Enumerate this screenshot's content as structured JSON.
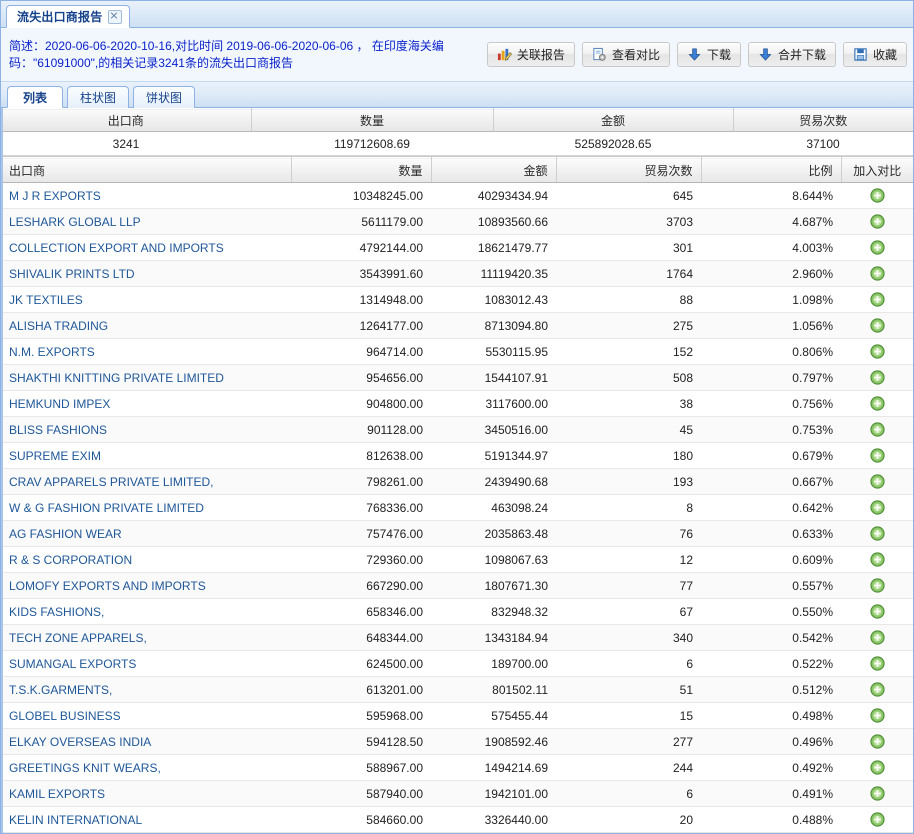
{
  "window": {
    "tab_label": "流失出口商报告",
    "close_icon": "close-icon"
  },
  "band": {
    "description_line1": "简述：2020-06-06-2020-10-16,对比时间 2019-06-06-2020-06-06 ， 在印度海关编",
    "description_line2": "码：\"61091000\",的相关记录3241条的流失出口商报告",
    "text_color": "#0a22cc"
  },
  "toolbar": {
    "buttons": [
      {
        "label": "关联报告",
        "icon": "bar-chart-edit-icon"
      },
      {
        "label": "查看对比",
        "icon": "document-settings-icon"
      },
      {
        "label": "下载",
        "icon": "download-arrow-icon"
      },
      {
        "label": "合并下载",
        "icon": "download-arrow-icon"
      },
      {
        "label": "收藏",
        "icon": "save-floppy-icon"
      }
    ]
  },
  "subtabs": [
    {
      "label": "列表",
      "active": true
    },
    {
      "label": "柱状图",
      "active": false
    },
    {
      "label": "饼状图",
      "active": false
    }
  ],
  "summary": {
    "headers": [
      "出口商",
      "数量",
      "金额",
      "贸易次数"
    ],
    "values": [
      "3241",
      "119712608.69",
      "525892028.65",
      "37100"
    ]
  },
  "detail": {
    "headers": [
      {
        "label": "出口商",
        "align": "l"
      },
      {
        "label": "数量",
        "align": "r"
      },
      {
        "label": "金额",
        "align": "r"
      },
      {
        "label": "贸易次数",
        "align": "r"
      },
      {
        "label": "比例",
        "align": "r"
      },
      {
        "label": "加入对比",
        "align": "c"
      }
    ],
    "action_icon": "add-circle-icon",
    "rows": [
      {
        "name": "M J R EXPORTS",
        "quantity": "10348245.00",
        "amount": "40293434.94",
        "trades": "645",
        "ratio": "8.644%"
      },
      {
        "name": "LESHARK GLOBAL LLP",
        "quantity": "5611179.00",
        "amount": "10893560.66",
        "trades": "3703",
        "ratio": "4.687%"
      },
      {
        "name": "COLLECTION EXPORT AND IMPORTS",
        "quantity": "4792144.00",
        "amount": "18621479.77",
        "trades": "301",
        "ratio": "4.003%"
      },
      {
        "name": "SHIVALIK PRINTS LTD",
        "quantity": "3543991.60",
        "amount": "11119420.35",
        "trades": "1764",
        "ratio": "2.960%"
      },
      {
        "name": "JK TEXTILES",
        "quantity": "1314948.00",
        "amount": "1083012.43",
        "trades": "88",
        "ratio": "1.098%"
      },
      {
        "name": "ALISHA TRADING",
        "quantity": "1264177.00",
        "amount": "8713094.80",
        "trades": "275",
        "ratio": "1.056%"
      },
      {
        "name": "N.M. EXPORTS",
        "quantity": "964714.00",
        "amount": "5530115.95",
        "trades": "152",
        "ratio": "0.806%"
      },
      {
        "name": "SHAKTHI KNITTING PRIVATE LIMITED",
        "quantity": "954656.00",
        "amount": "1544107.91",
        "trades": "508",
        "ratio": "0.797%"
      },
      {
        "name": "HEMKUND IMPEX",
        "quantity": "904800.00",
        "amount": "3117600.00",
        "trades": "38",
        "ratio": "0.756%"
      },
      {
        "name": "BLISS FASHIONS",
        "quantity": "901128.00",
        "amount": "3450516.00",
        "trades": "45",
        "ratio": "0.753%"
      },
      {
        "name": "SUPREME EXIM",
        "quantity": "812638.00",
        "amount": "5191344.97",
        "trades": "180",
        "ratio": "0.679%"
      },
      {
        "name": "CRAV APPARELS PRIVATE LIMITED,",
        "quantity": "798261.00",
        "amount": "2439490.68",
        "trades": "193",
        "ratio": "0.667%"
      },
      {
        "name": "W & G FASHION PRIVATE LIMITED",
        "quantity": "768336.00",
        "amount": "463098.24",
        "trades": "8",
        "ratio": "0.642%"
      },
      {
        "name": "AG FASHION WEAR",
        "quantity": "757476.00",
        "amount": "2035863.48",
        "trades": "76",
        "ratio": "0.633%"
      },
      {
        "name": "R & S CORPORATION",
        "quantity": "729360.00",
        "amount": "1098067.63",
        "trades": "12",
        "ratio": "0.609%"
      },
      {
        "name": "LOMOFY EXPORTS AND IMPORTS",
        "quantity": "667290.00",
        "amount": "1807671.30",
        "trades": "77",
        "ratio": "0.557%"
      },
      {
        "name": "KIDS FASHIONS,",
        "quantity": "658346.00",
        "amount": "832948.32",
        "trades": "67",
        "ratio": "0.550%"
      },
      {
        "name": "TECH ZONE APPARELS,",
        "quantity": "648344.00",
        "amount": "1343184.94",
        "trades": "340",
        "ratio": "0.542%"
      },
      {
        "name": "SUMANGAL EXPORTS",
        "quantity": "624500.00",
        "amount": "189700.00",
        "trades": "6",
        "ratio": "0.522%"
      },
      {
        "name": "T.S.K.GARMENTS,",
        "quantity": "613201.00",
        "amount": "801502.11",
        "trades": "51",
        "ratio": "0.512%"
      },
      {
        "name": "GLOBEL BUSINESS",
        "quantity": "595968.00",
        "amount": "575455.44",
        "trades": "15",
        "ratio": "0.498%"
      },
      {
        "name": "ELKAY OVERSEAS INDIA",
        "quantity": "594128.50",
        "amount": "1908592.46",
        "trades": "277",
        "ratio": "0.496%"
      },
      {
        "name": "GREETINGS KNIT WEARS,",
        "quantity": "588967.00",
        "amount": "1494214.69",
        "trades": "244",
        "ratio": "0.492%"
      },
      {
        "name": "KAMIL EXPORTS",
        "quantity": "587940.00",
        "amount": "1942101.00",
        "trades": "6",
        "ratio": "0.491%"
      },
      {
        "name": "KELIN INTERNATIONAL",
        "quantity": "584660.00",
        "amount": "3326440.00",
        "trades": "20",
        "ratio": "0.488%"
      }
    ]
  },
  "colors": {
    "link": "#1e5799",
    "tab_text": "#15428b",
    "accent_border": "#8db2e3",
    "add_icon_green": "#5aa83c"
  }
}
